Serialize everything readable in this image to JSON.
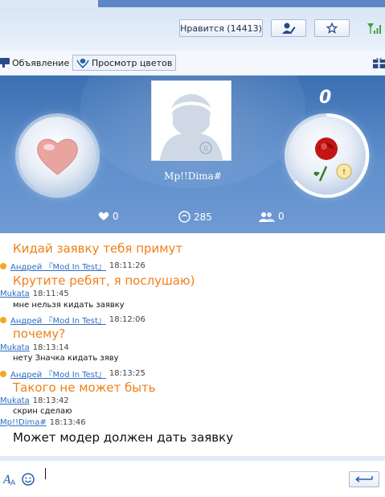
{
  "header": {
    "likes_button": "Нравится (14413)",
    "icons": [
      "user-edit-icon",
      "star-icon",
      "signal-icon"
    ]
  },
  "toolbar": {
    "announcement": "Объявление",
    "flowers": "Просмотр цветов"
  },
  "room": {
    "nickname": "Mp!!Dima#",
    "gift_count": "0",
    "stats": {
      "hearts": "0",
      "views": "285",
      "members": "0"
    }
  },
  "chat": {
    "messages": [
      {
        "type": "big",
        "text": "Кидай заявку тебя примут"
      },
      {
        "type": "meta",
        "badge": true,
        "user": "Андрей 『Mod In Test』",
        "time": "18:11:26"
      },
      {
        "type": "big",
        "text": "Крутите ребят, я послушаю)"
      },
      {
        "type": "meta",
        "badge": false,
        "user": "Mukata",
        "time": "18:11:45"
      },
      {
        "type": "small",
        "text": "мне нельзя кидать заявку"
      },
      {
        "type": "meta",
        "badge": true,
        "user": "Андрей 『Mod In Test』",
        "time": "18:12:06"
      },
      {
        "type": "big",
        "text": "почему?"
      },
      {
        "type": "meta",
        "badge": false,
        "user": "Mukata",
        "time": "18:13:14"
      },
      {
        "type": "small",
        "text": "нету Значка кидать зяву"
      },
      {
        "type": "meta",
        "badge": true,
        "user": "Андрей 『Mod In Test』",
        "time": "18:13:25"
      },
      {
        "type": "big",
        "text": "Такого не может быть"
      },
      {
        "type": "meta",
        "badge": false,
        "user": "Mukata",
        "time": "18:13:42"
      },
      {
        "type": "small",
        "text": "скрин сделаю"
      },
      {
        "type": "meta",
        "badge": false,
        "user": "Mp!!Dima#",
        "time": "18:13:46"
      },
      {
        "type": "bigblack",
        "text": "Может модер должен дать заявку"
      }
    ]
  },
  "input": {
    "value": "",
    "icons": [
      "font-icon",
      "smiley-icon",
      "send-icon"
    ]
  },
  "colors": {
    "accent_orange": "#f07f1a",
    "link_blue": "#2e6dc3",
    "banner_blue": "#4a7ec0"
  }
}
